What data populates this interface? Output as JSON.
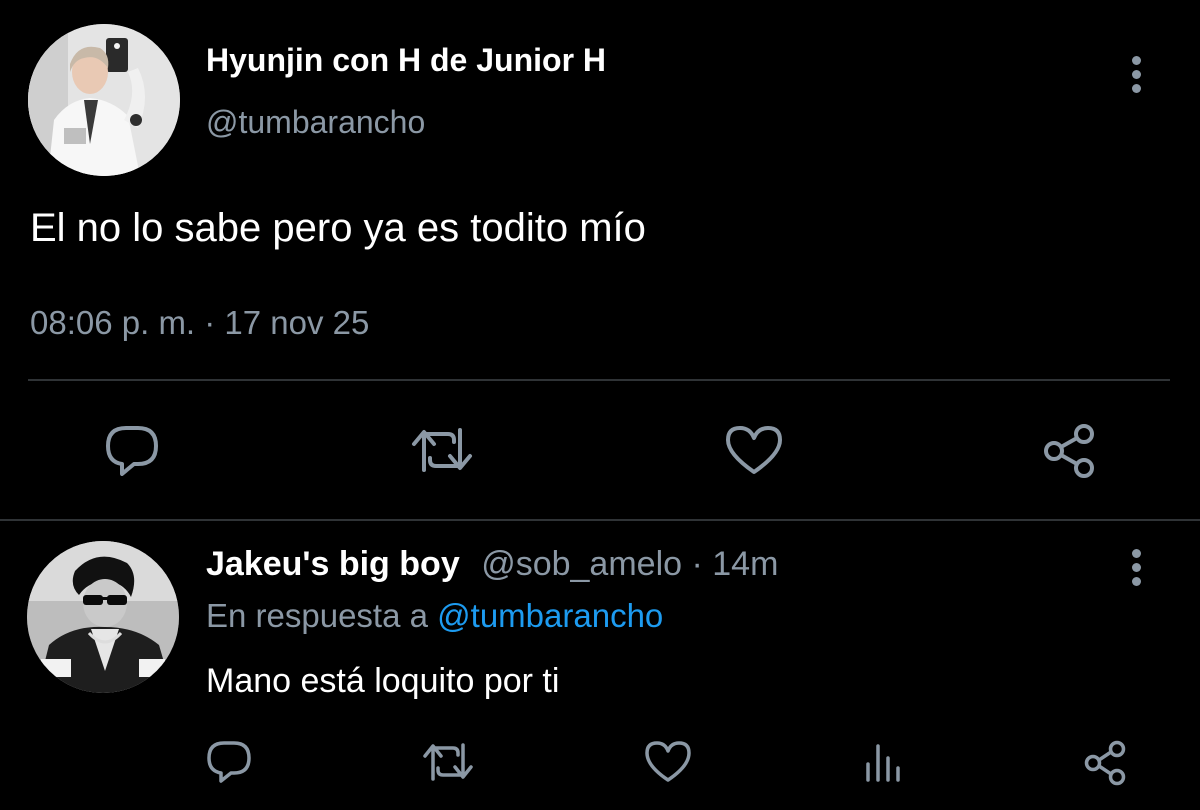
{
  "main_tweet": {
    "display_name": "Hyunjin con H de Junior H",
    "handle": "@tumbarancho",
    "text": "El no lo sabe pero ya es todito mío",
    "timestamp": "08:06 p. m. · 17 nov 25",
    "actions": [
      "reply-icon",
      "retweet-icon",
      "like-icon",
      "share-icon"
    ]
  },
  "reply_tweet": {
    "display_name": "Jakeu's big boy",
    "handle": "@sob_amelo",
    "separator": " · ",
    "time_ago": "14m",
    "replying_prefix": "En respuesta a ",
    "replying_to": "@tumbarancho",
    "text": "Mano está loquito por ti",
    "actions": [
      "reply-icon",
      "retweet-icon",
      "like-icon",
      "analytics-icon",
      "share-icon"
    ]
  },
  "colors": {
    "background": "#000000",
    "primary_text": "#ffffff",
    "secondary_text": "#8b98a5",
    "divider": "#2f3336",
    "link": "#1d9bf0"
  }
}
